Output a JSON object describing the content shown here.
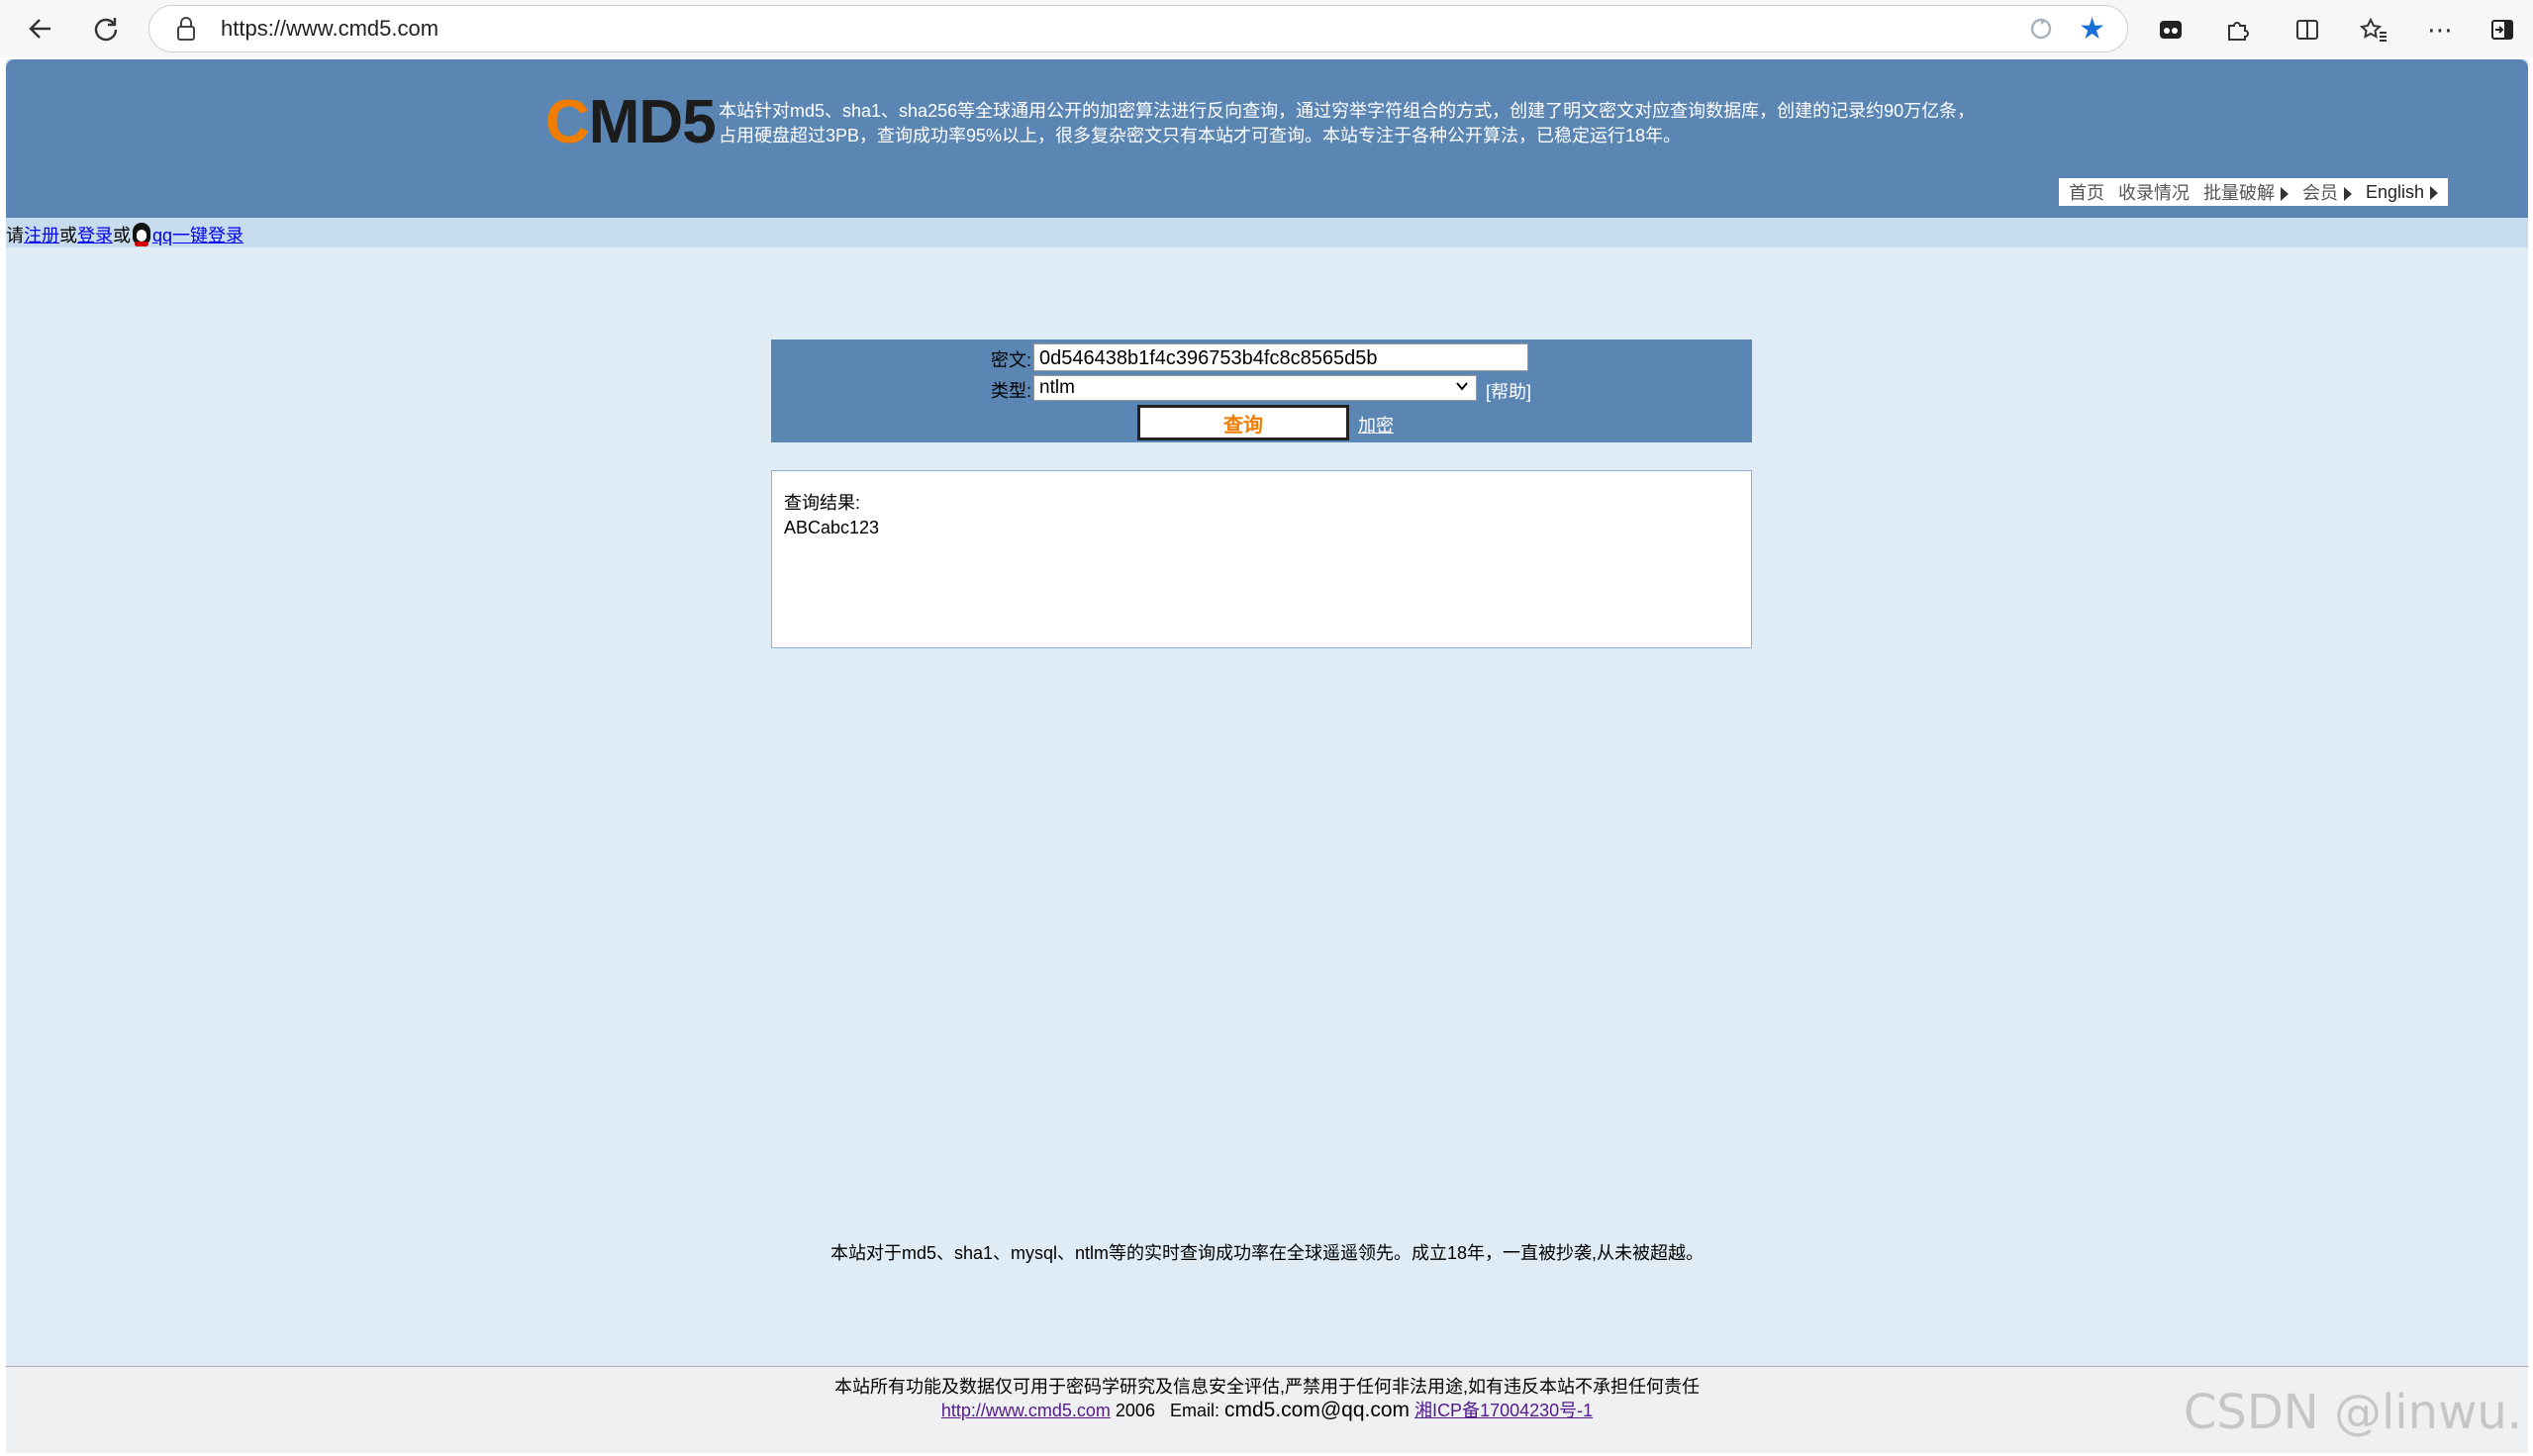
{
  "browser": {
    "url": "https://www.cmd5.com"
  },
  "site": {
    "logo_c": "C",
    "logo_rest": "MD5",
    "intro_line1": "本站针对md5、sha1、sha256等全球通用公开的加密算法进行反向查询，通过穷举字符组合的方式，创建了明文密文对应查询数据库，创建的记录约90万亿条，",
    "intro_line2": "占用硬盘超过3PB，查询成功率95%以上，很多复杂密文只有本站才可查询。本站专注于各种公开算法，已稳定运行18年。",
    "nav": [
      "首页",
      "收录情况",
      "批量破解",
      "会员",
      "English"
    ]
  },
  "login": {
    "prefix": "请",
    "register": "注册",
    "or1": "或",
    "login": "登录",
    "or2": "或",
    "qq": "qq一键登录"
  },
  "form": {
    "cipher_label": "密文:",
    "cipher_value": "0d546438b1f4c396753b4fc8c8565d5b",
    "type_label": "类型:",
    "type_value": "ntlm",
    "help": "[帮助]",
    "query_button": "查询",
    "encrypt_link": "加密"
  },
  "result": {
    "title": "查询结果:",
    "value": "ABCabc123"
  },
  "slogan": "本站对于md5、sha1、mysql、ntlm等的实时查询成功率在全球遥遥领先。成立18年，一直被抄袭,从未被超越。",
  "footer": {
    "disclaimer": "本站所有功能及数据仅可用于密码学研究及信息安全评估,严禁用于任何非法用途,如有违反本站不承担任何责任",
    "site_link": "http://www.cmd5.com",
    "year": "2006",
    "email_label": "Email:",
    "email": "cmd5.com@qq.com",
    "icp": "湘ICP备17004230号-1"
  },
  "watermark": "CSDN @linwu."
}
